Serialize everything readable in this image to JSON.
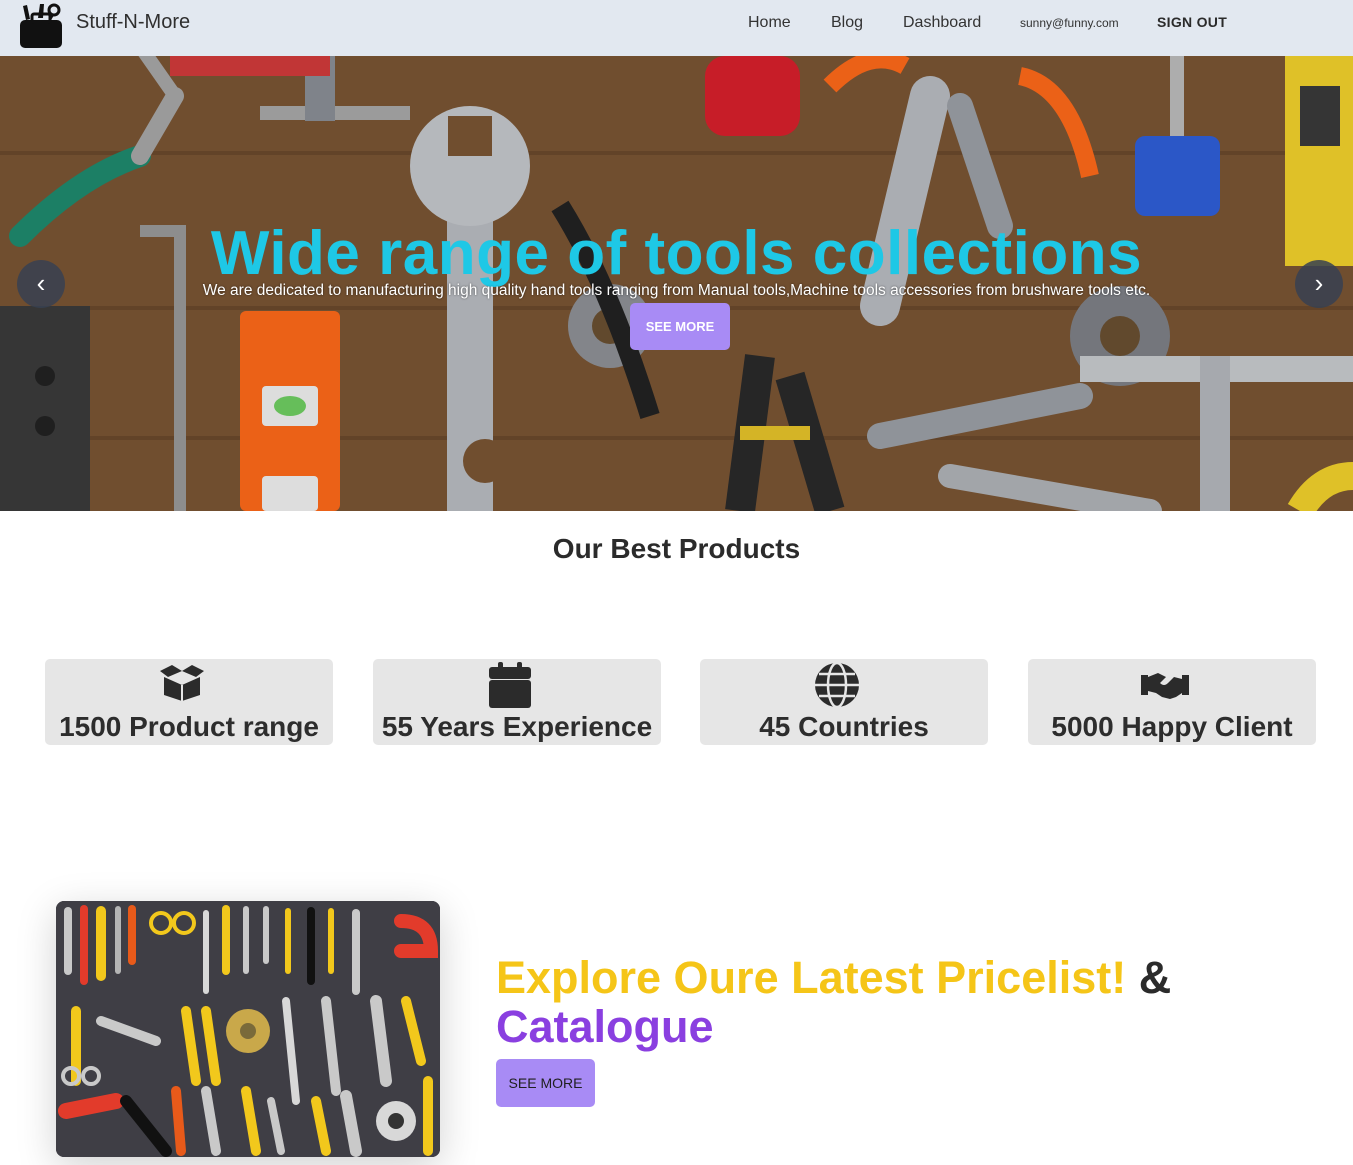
{
  "navbar": {
    "brand": "Stuff-N-More",
    "links": [
      "Home",
      "Blog",
      "Dashboard"
    ],
    "user_email": "sunny@funny.com",
    "sign_out": "SIGN OUT"
  },
  "hero": {
    "title": "Wide range of tools collections",
    "subtitle": "We are dedicated to manufacturing high quality hand tools ranging from Manual tools,Machine tools accessories from brushware tools etc.",
    "button": "SEE MORE",
    "prev_icon": "‹",
    "next_icon": "›"
  },
  "best_products": {
    "title": "Our Best Products",
    "stats": [
      {
        "icon": "box-icon",
        "label": "1500 Product range"
      },
      {
        "icon": "calendar-icon",
        "label": "55 Years Experience"
      },
      {
        "icon": "globe-icon",
        "label": "45 Countries"
      },
      {
        "icon": "handshake-icon",
        "label": "5000 Happy Client"
      }
    ]
  },
  "catalogue": {
    "title_yellow": "Explore Oure Latest Pricelist!",
    "title_amp": "&",
    "title_purple": "Catalogue",
    "button": "SEE MORE"
  },
  "colors": {
    "navbar_bg": "#e2e8f0",
    "hero_title": "#1ec8e6",
    "button_bg": "#a88bf5",
    "card_bg": "#e6e6e6",
    "accent_yellow": "#f5c518",
    "accent_purple": "#8a3fe0"
  }
}
